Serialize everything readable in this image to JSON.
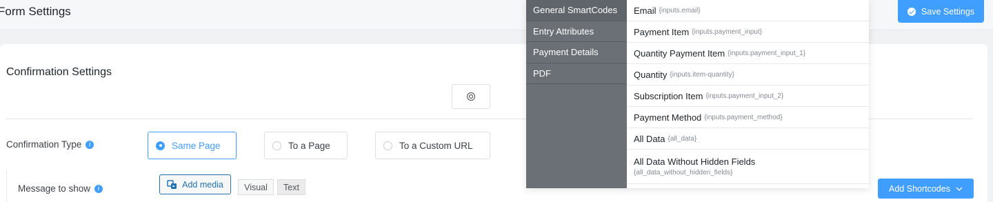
{
  "header": {
    "title": "Form Settings",
    "save_label": "Save Settings"
  },
  "card": {
    "title": "Confirmation Settings"
  },
  "confirmation_type": {
    "label": "Confirmation Type",
    "options": [
      {
        "label": "Same Page",
        "selected": true
      },
      {
        "label": "To a Page",
        "selected": false
      },
      {
        "label": "To a Custom URL",
        "selected": false
      }
    ]
  },
  "message": {
    "label": "Message to show",
    "add_media_label": "Add media",
    "tabs": [
      "Visual",
      "Text"
    ],
    "add_shortcodes_label": "Add Shortcodes"
  },
  "shortcodes_dropdown": {
    "categories": [
      {
        "label": "General SmartCodes",
        "active": true
      },
      {
        "label": "Entry Attributes",
        "active": false
      },
      {
        "label": "Payment Details",
        "active": false
      },
      {
        "label": "PDF",
        "active": false
      }
    ],
    "items": [
      {
        "name": "Email",
        "code": "{inputs.email}"
      },
      {
        "name": "Payment Item",
        "code": "{inputs.payment_input}"
      },
      {
        "name": "Quantity Payment Item",
        "code": "{inputs.payment_input_1}"
      },
      {
        "name": "Quantity",
        "code": "{inputs.item-quantity}"
      },
      {
        "name": "Subscription Item",
        "code": "{inputs.payment_input_2}"
      },
      {
        "name": "Payment Method",
        "code": "{inputs.payment_method}"
      },
      {
        "name": "All Data",
        "code": "{all_data}"
      },
      {
        "name": "All Data Without Hidden Fields",
        "code": "{all_data_without_hidden_fields}"
      }
    ]
  },
  "colors": {
    "accent": "#409eff",
    "dropdown_sidebar": "#6b7077"
  },
  "icons": {
    "save": "check-circle-icon",
    "info": "info-icon",
    "media": "media-icon",
    "chevron": "chevron-down-icon",
    "settings_box": "circle-icon"
  }
}
